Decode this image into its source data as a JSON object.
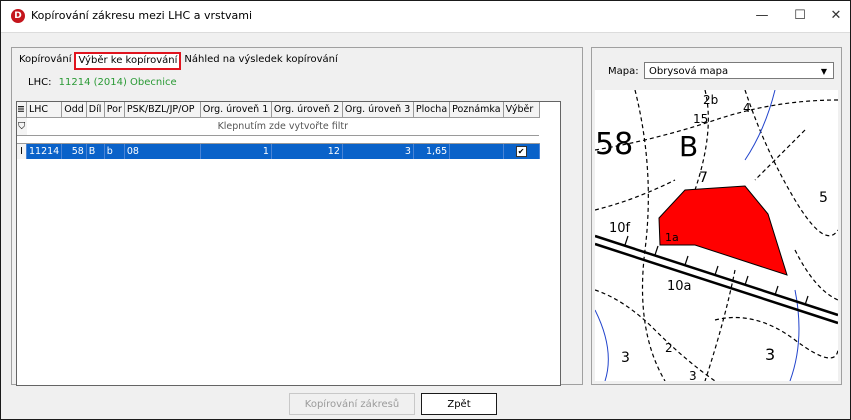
{
  "window": {
    "title": "Kopírování zákresu mezi LHC a vrstvami",
    "app_icon_letter": "D",
    "minimize_glyph": "—",
    "maximize_glyph": "☐",
    "close_glyph": "✕"
  },
  "tabs": [
    {
      "label": "Kopírování",
      "active": false
    },
    {
      "label": "Výběr ke kopírování",
      "active": true
    },
    {
      "label": "Náhled na výsledek kopírování",
      "active": false
    }
  ],
  "lhc": {
    "label": "LHC:",
    "value": "11214 (2014)  Obecnice"
  },
  "grid": {
    "columns": [
      "LHC",
      "Odd",
      "Díl",
      "Por",
      "PSK/BZL/JP/OP",
      "Org. úroveň 1",
      "Org. úroveň 2",
      "Org. úroveň 3",
      "Plocha",
      "Poznámka",
      "Výběr"
    ],
    "filter_hint": "Klepnutím zde vytvořte filtr",
    "rows": [
      {
        "lhc": "11214",
        "odd": "58",
        "dil": "B",
        "por": "b",
        "psk": "08",
        "org1": "1",
        "org2": "12",
        "org3": "3",
        "plocha": "1,65",
        "poznamka": "",
        "vyber_checked": "✔"
      }
    ]
  },
  "map": {
    "label": "Mapa:",
    "selected": "Obrysová mapa",
    "arrow": "▼",
    "labels": [
      "58",
      "B",
      "2b",
      "15",
      "4",
      "7",
      "10f",
      "1a",
      "10a",
      "5",
      "3",
      "2",
      "3",
      "3"
    ],
    "highlight_color": "#ff0000"
  },
  "buttons": {
    "copy": "Kopírování zákresů",
    "back": "Zpět"
  },
  "colors": {
    "selection": "#0a62c9",
    "active_tab_border": "#e0141e",
    "lhc_value": "#2a9a35"
  }
}
